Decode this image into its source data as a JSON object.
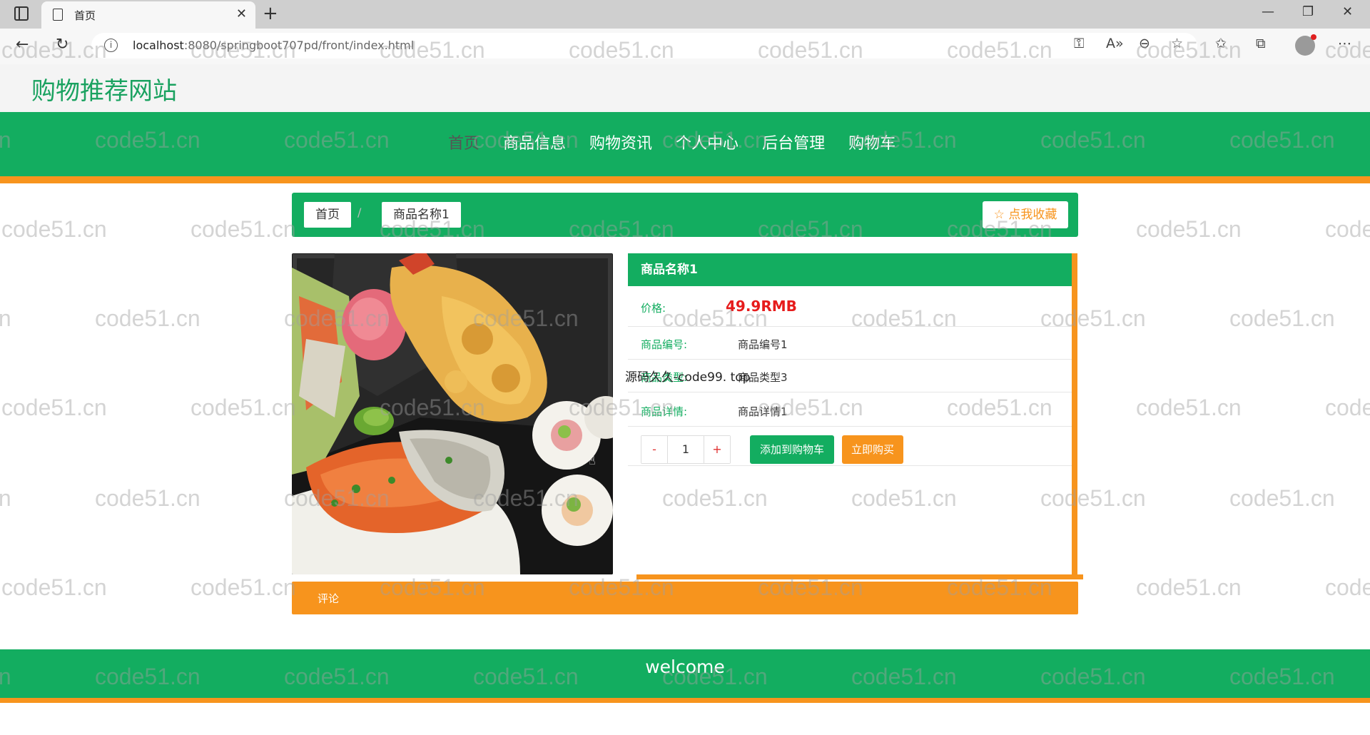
{
  "browser": {
    "tab_title": "首页",
    "url_host": "localhost",
    "url_rest": ":8080/springboot707pd/front/index.html"
  },
  "site": {
    "title": "购物推荐网站",
    "nav": [
      "首页",
      "商品信息",
      "购物资讯",
      "个人中心",
      "后台管理",
      "购物车"
    ],
    "active_nav_index": 0
  },
  "breadcrumb": {
    "home": "首页",
    "separator": "/",
    "current": "商品名称1"
  },
  "favorite_label": "☆ 点我收藏",
  "product": {
    "name": "商品名称1",
    "price_label": "价格:",
    "price": "49.9RMB",
    "fields": [
      {
        "label": "商品编号:",
        "value": "商品编号1"
      },
      {
        "label": "商品类型:",
        "value": "商品类型3"
      },
      {
        "label": "商品详情:",
        "value": "商品详情1"
      }
    ],
    "quantity": "1",
    "minus": "-",
    "plus": "+",
    "add_to_cart": "添加到购物车",
    "buy_now": "立即购买"
  },
  "comment_label": "评论",
  "footer_text": "welcome",
  "overlay_text": "源码久久-code99. top",
  "watermark_text": "code51.cn",
  "colors": {
    "brand_green": "#13ad60",
    "accent_orange": "#f7941d",
    "price_red": "#e61c1c"
  }
}
